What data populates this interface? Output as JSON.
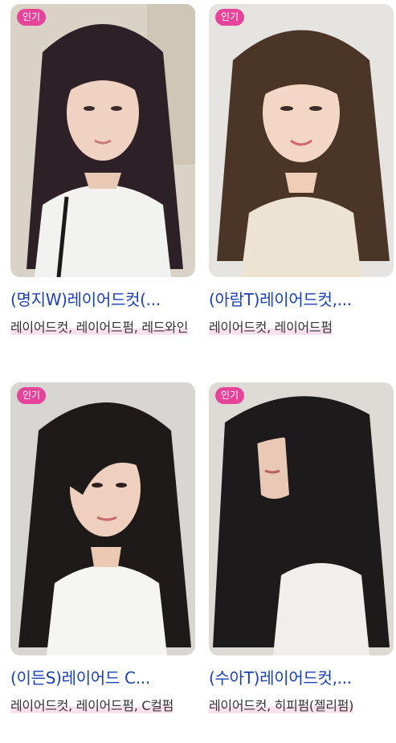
{
  "badge_label": "인기",
  "colors": {
    "badge_bg": "#e5449a",
    "title": "#1b3fb5",
    "tag_text": "#333333",
    "tag_highlight": "#fbe0ee"
  },
  "cards": [
    {
      "title": "(명지W)레이어드컷(...",
      "tags": [
        "레이어드컷",
        "레이어드펌",
        "레드와인"
      ],
      "tags_text": "레이어드컷, 레이어드펌, 레드와인"
    },
    {
      "title": "(아람T)레이어드컷,...",
      "tags": [
        "레이어드컷",
        "레이어드펌"
      ],
      "tags_text": "레이어드컷, 레이어드펌"
    },
    {
      "title": "(이든S)레이어드 C...",
      "tags": [
        "레이어드컷",
        "레이어드펌",
        "C컬펌"
      ],
      "tags_text": "레이어드컷, 레이어드펌, C컬펌"
    },
    {
      "title": "(수아T)레이어드컷,...",
      "tags": [
        "레이어드컷",
        "히피펌(젤리펌)"
      ],
      "tags_text": "레이어드컷, 히피펌(젤리펌)"
    }
  ]
}
